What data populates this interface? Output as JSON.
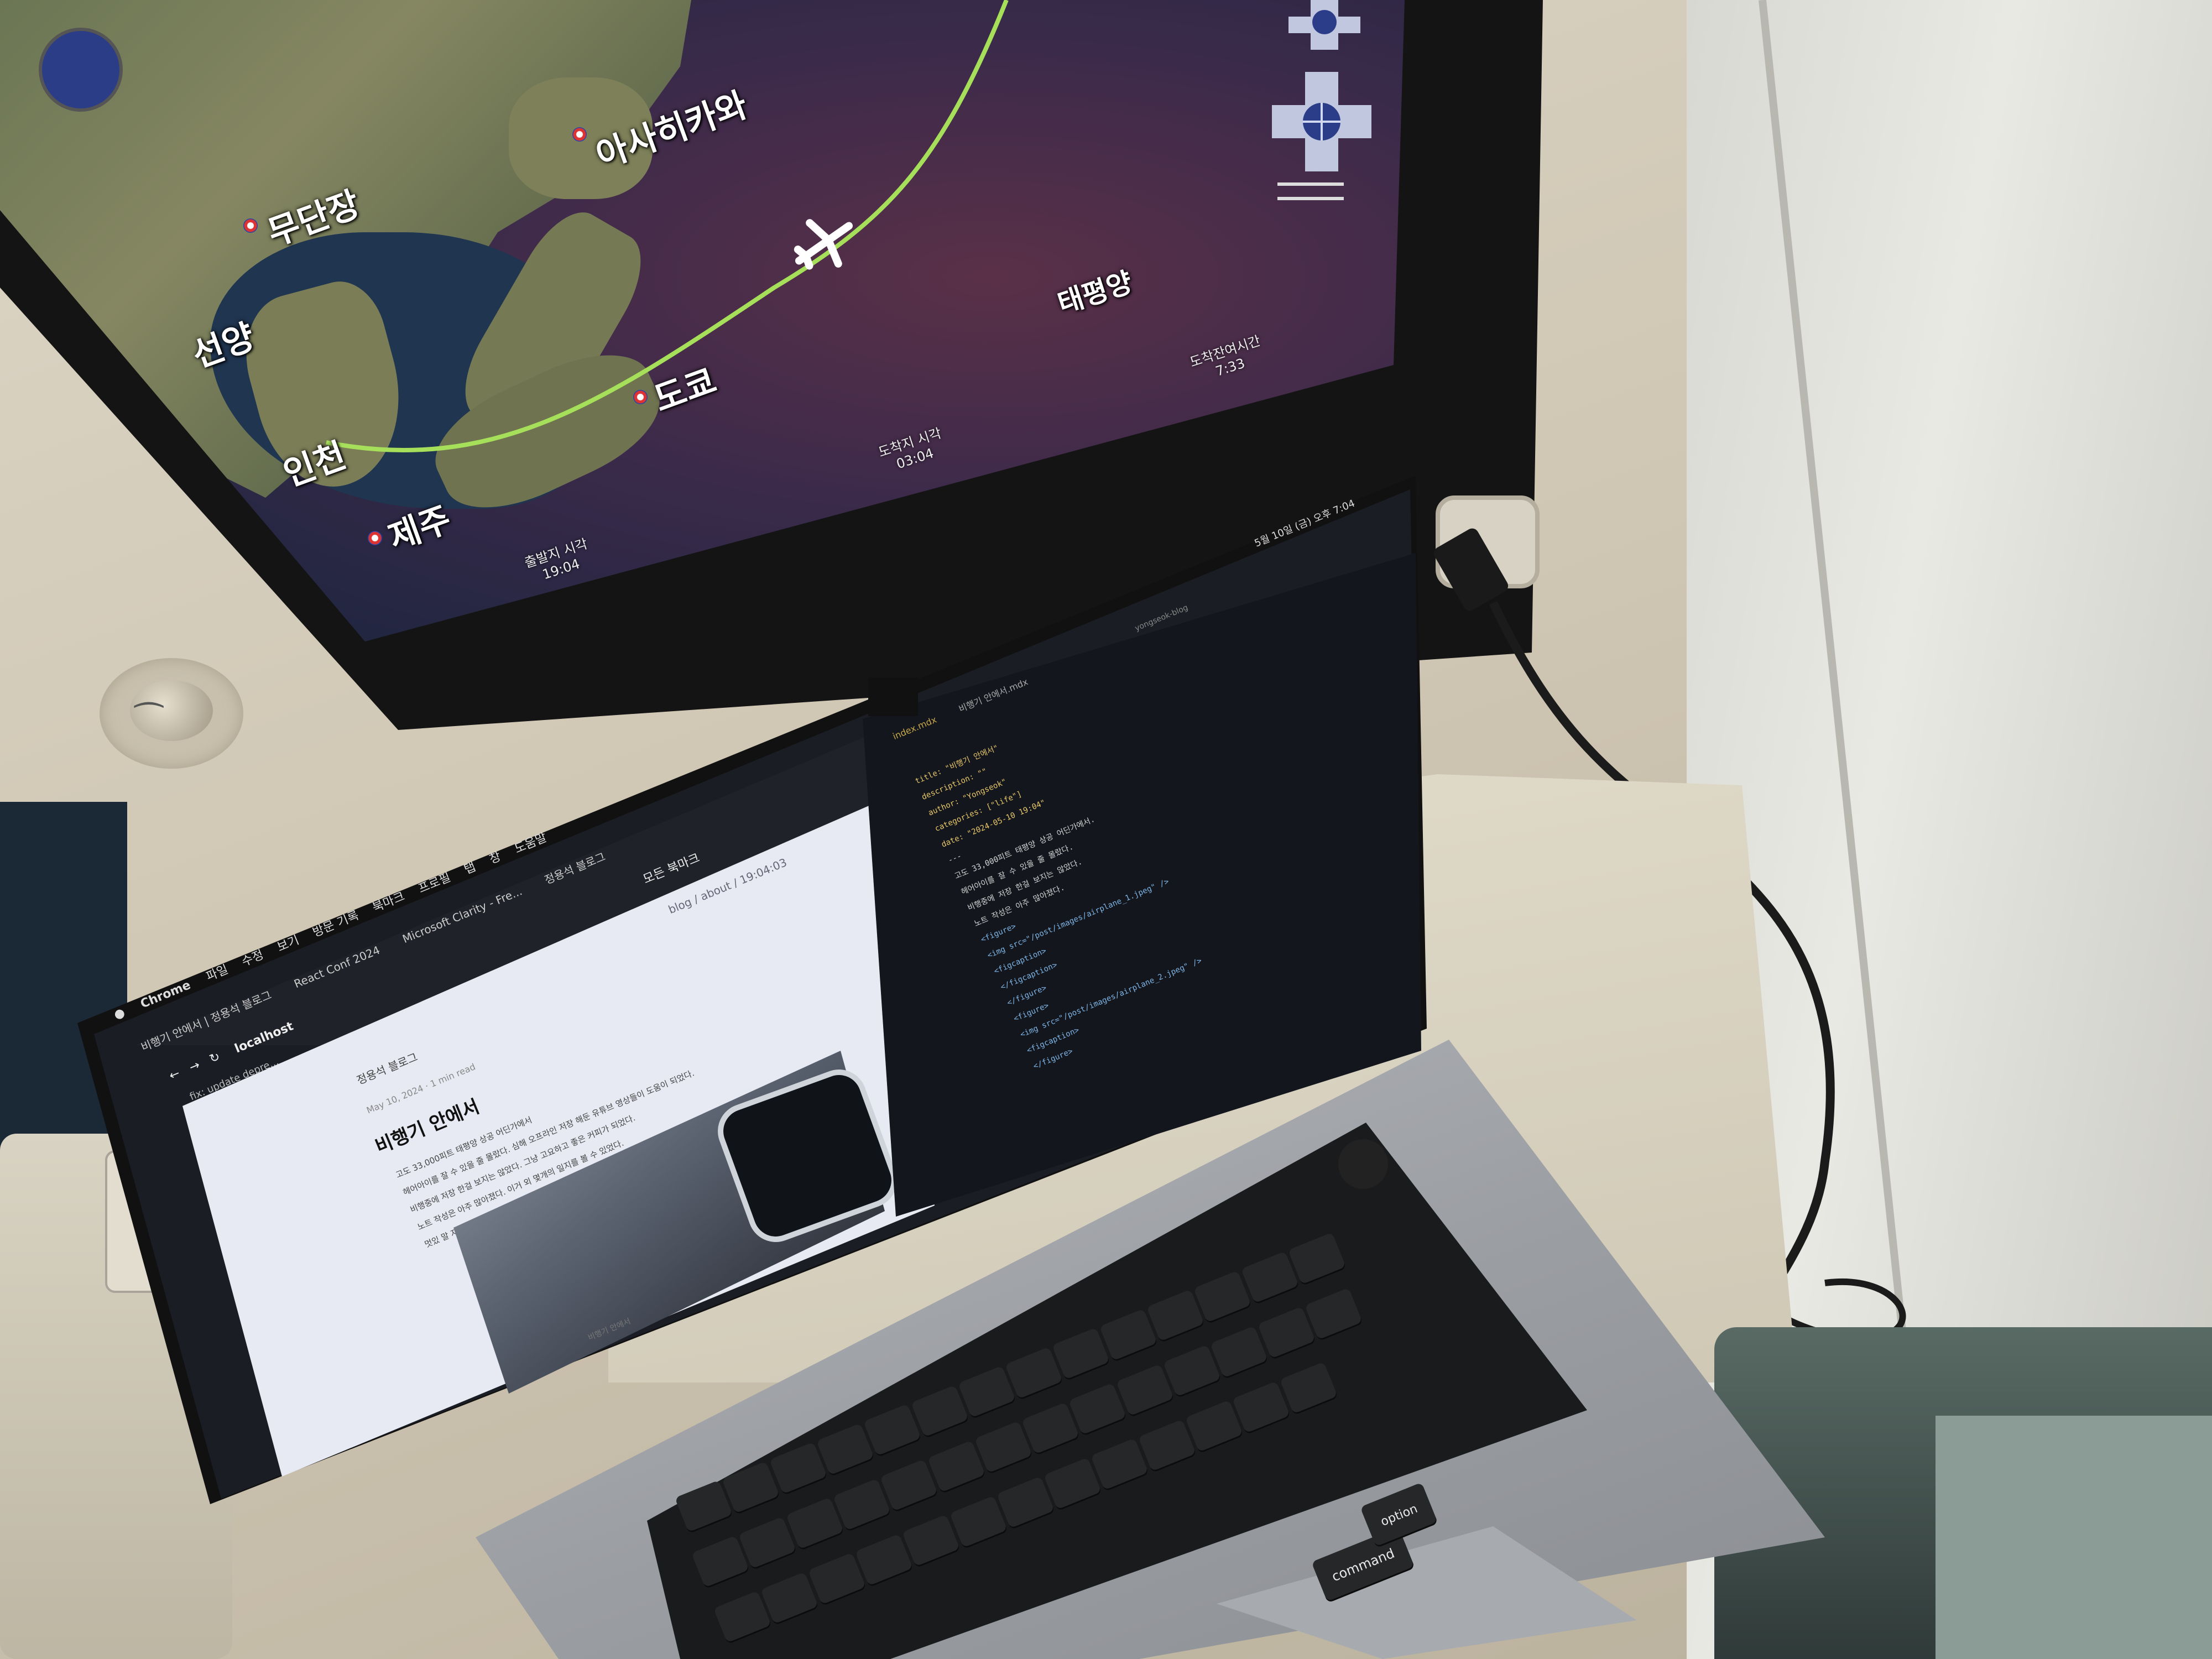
{
  "monitor": {
    "map_labels": [
      {
        "text": "아사히카와"
      },
      {
        "text": "무단장"
      },
      {
        "text": "선양"
      },
      {
        "text": "인천"
      },
      {
        "text": "제주"
      },
      {
        "text": "도쿄"
      },
      {
        "text": "태평양"
      }
    ],
    "departure": {
      "label": "출발지 시각",
      "time": "19:04"
    },
    "arrival": {
      "label": "도착지 시각",
      "time": "03:04"
    },
    "remaining": {
      "label": "도착잔여시간",
      "time": "7:33"
    }
  },
  "laptop": {
    "menubar": {
      "app": "Chrome",
      "items": [
        "파일",
        "수정",
        "보기",
        "방문 기록",
        "북마크",
        "프로필",
        "탭",
        "창",
        "도움말"
      ],
      "clock": "5월 10일 (금) 오후 7:04"
    },
    "browser": {
      "tabs": [
        "비행기 안에서 | 정용석 블로그",
        "React Conf 2024",
        "Microsoft Clarity - Fre...",
        "정용석 블로그"
      ],
      "url": "localhost",
      "bookmark": "fix: update depre...",
      "bookmarks_right": "모든 북마크",
      "breadcrumb": "blog / about / 19:04:03",
      "site_name": "정용석 블로그",
      "post_meta": "May 10, 2024 · 1 min read",
      "post_title": "비행기 안에서",
      "post_lines": [
        "고도 33,000피트 태평양 상공 어딘가에서",
        "헤어아이를 잘 수 있을 줄 몰랐다. 심해 오프라인 저장 해둔 유튜브 영상들이 도움이 되었다.",
        "비행중에 저장 한걸 보지는 않았다. 그냥 고요하고 좋은 커피가 되었다.",
        "노트 작성은 아주 많아졌다. 이거 외 몇개의 일지를 볼 수 있었다.",
        "멋있 말 자리 사람이 영문을 할 확인하고 노트 흐릿하고 말이 있었다."
      ],
      "image_caption": "비행기 안에서"
    },
    "editor": {
      "file_tab": "index.mdx",
      "file_tab2": "비행기 안에서.mdx",
      "title_path": "yongseok-blog",
      "code_lines": [
        "title: \"비행기 안에서\"",
        "description: \"\"",
        "author: \"Yongseok\"",
        "categories: [\"life\"]",
        "date: \"2024-05-10 19:04\"",
        "---",
        "고도 33,000피트 태평양 상공 어딘가에서.",
        "헤어아이를 잘 수 있을 줄 몰랐다.",
        "비행중에 저장 한걸 보지는 않았다.",
        "노트 작성은 아주 많아졌다.",
        "<figure>",
        "  <img src=\"/post/images/airplane_1.jpeg\" />",
        "  <figcaption>",
        "  </figcaption>",
        "</figure>",
        "<figure>",
        "  <img src=\"/post/images/airplane_2.jpeg\" />",
        "  <figcaption>",
        "</figure>"
      ]
    },
    "keys": {
      "command": "command",
      "option": "option"
    }
  },
  "colors": {
    "flight_path": "#a6e05a",
    "map_sea": "#3b2a4a",
    "editor_bg": "#13161c",
    "keyboard": "#1a1b1d"
  }
}
